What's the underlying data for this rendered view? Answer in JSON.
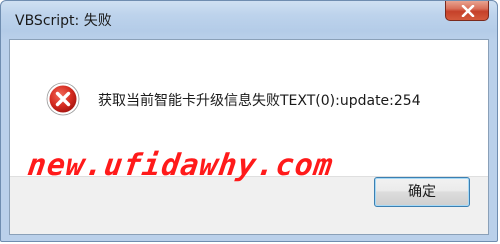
{
  "window": {
    "title": "VBScript: 失败"
  },
  "icon": {
    "close": "close-icon",
    "error": "error-icon"
  },
  "dialog": {
    "message": "获取当前智能卡升级信息失败TEXT(0):update:254",
    "ok_label": "确定",
    "watermark": "new.ufidawhy.com"
  },
  "colors": {
    "error_red": "#d42a1f",
    "watermark_red": "#ff1a1a",
    "close_button": "#c5412a",
    "titlebar": "#b4cce8"
  }
}
